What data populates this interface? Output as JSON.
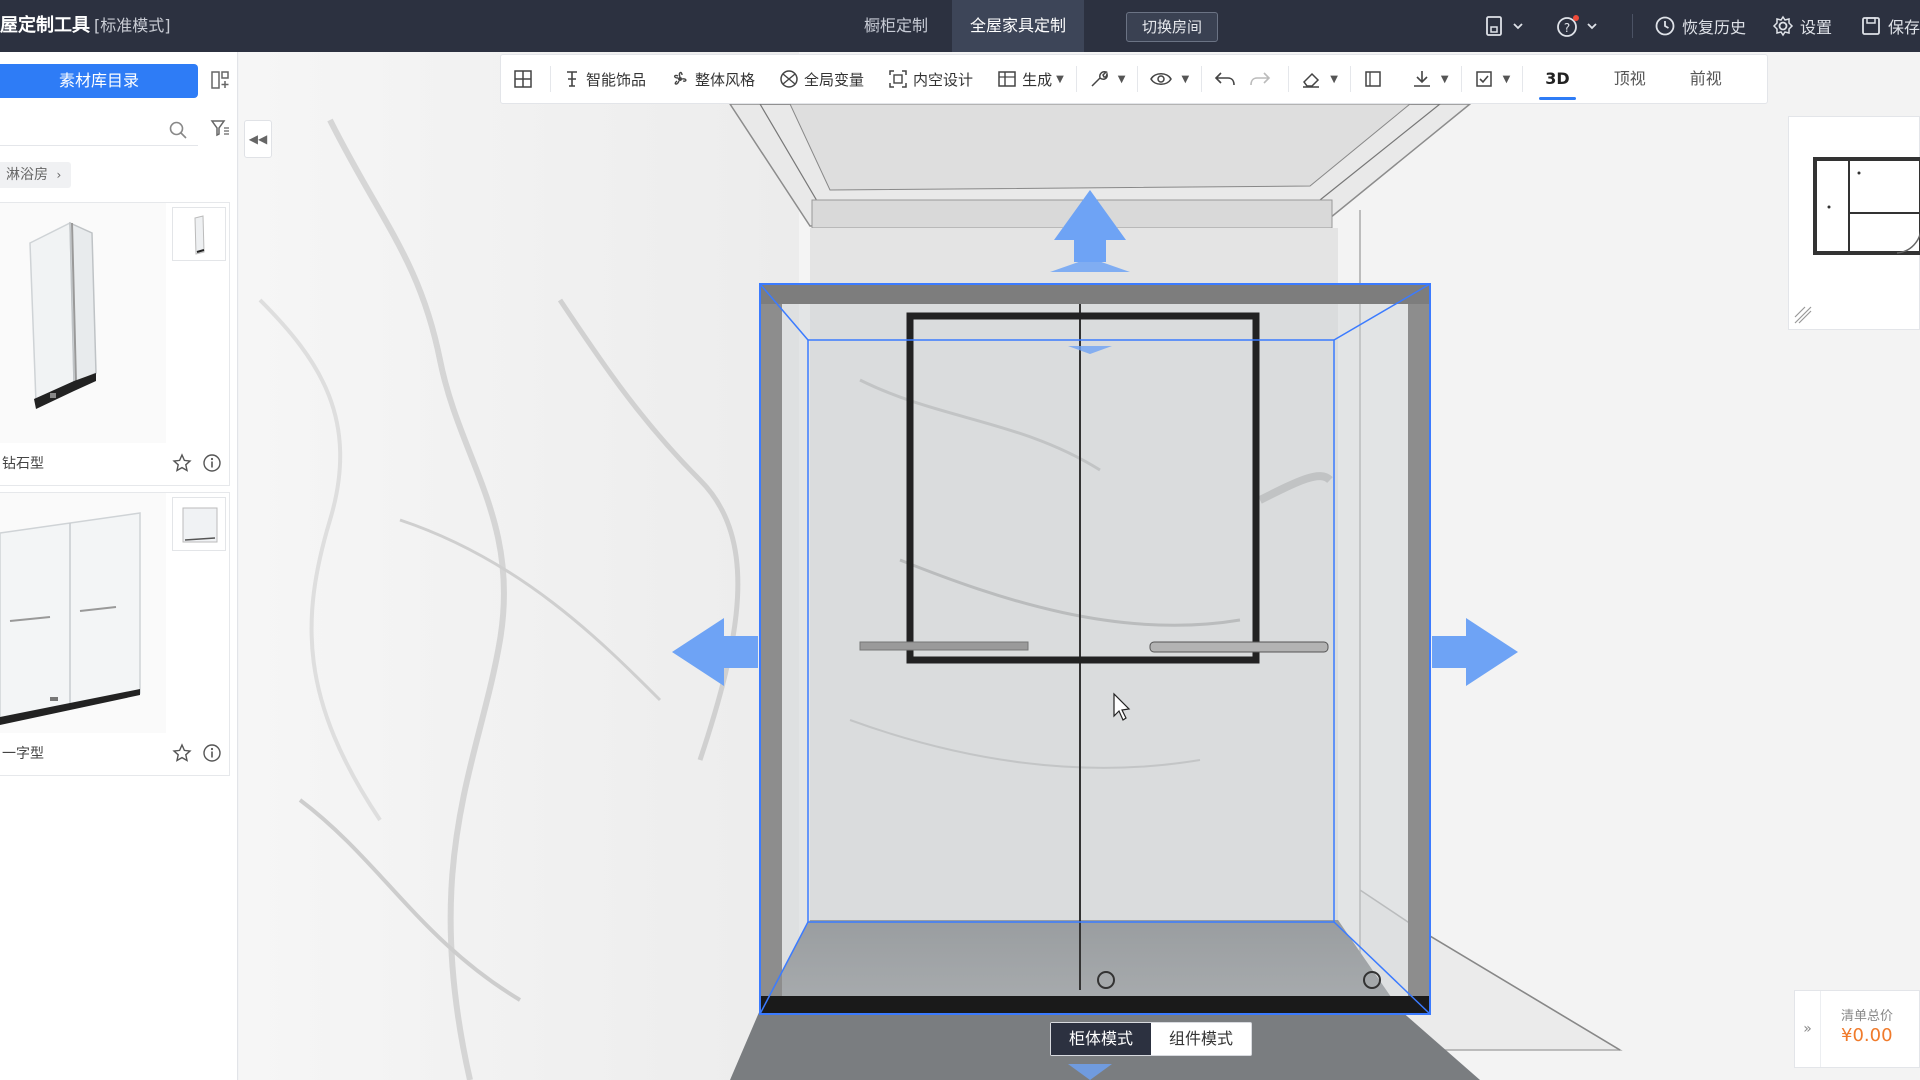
{
  "header": {
    "app_title": "屋定制工具",
    "mode_label": "[标准模式]",
    "tabs": [
      {
        "label": "橱柜定制"
      },
      {
        "label": "全屋家具定制"
      }
    ],
    "switch_room": "切换房间",
    "restore_history": "恢复历史",
    "settings": "设置",
    "save": "保存"
  },
  "left_panel": {
    "catalog_button": "素材库目录",
    "search_placeholder": "",
    "breadcrumb": "淋浴房",
    "products": [
      {
        "name": "钻石型"
      },
      {
        "name": "一字型"
      }
    ]
  },
  "toolbar": {
    "tools": [
      {
        "label": "智能饰品"
      },
      {
        "label": "整体风格"
      },
      {
        "label": "全局变量"
      },
      {
        "label": "内空设计"
      },
      {
        "label": "生成"
      }
    ],
    "view_tabs": [
      {
        "label": "3D"
      },
      {
        "label": "顶视"
      },
      {
        "label": "前视"
      }
    ],
    "active_view": "3D"
  },
  "mode_switch": {
    "cabinet_mode": "柜体模式",
    "component_mode": "组件模式",
    "active": "柜体模式"
  },
  "price": {
    "label": "清单总价",
    "value": "¥0.00"
  },
  "colors": {
    "topbar": "#2c3140",
    "accent": "#2e7cf6",
    "selection": "#3b7bff",
    "arrow": "#6ea3f5",
    "price": "#f07a2a"
  }
}
